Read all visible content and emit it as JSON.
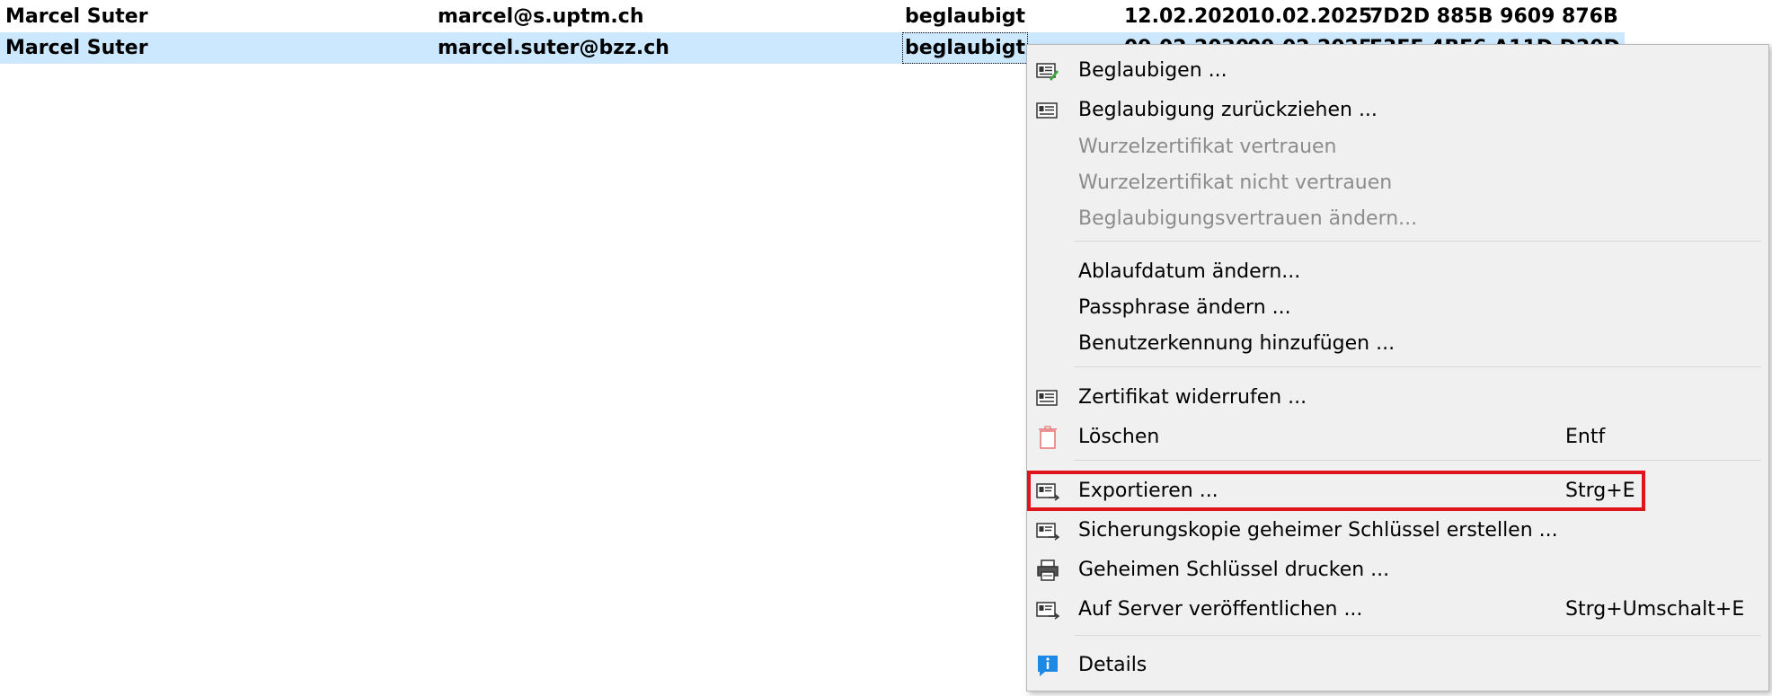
{
  "rows": [
    {
      "name": "Marcel Suter",
      "email": "marcel@s.uptm.ch",
      "status": "beglaubigt",
      "created": "12.02.2020",
      "expires": "10.02.2025",
      "fingerprint": "7D2D 885B 9609 876B"
    },
    {
      "name": "Marcel Suter",
      "email": "marcel.suter@bzz.ch",
      "status": "beglaubigt",
      "created": "09.02.2020",
      "expires": "09.02.2025",
      "fingerprint": "E3EF 4BE6 A11D D20D"
    }
  ],
  "menu": {
    "items": [
      {
        "label": "Beglaubigen ...",
        "icon": "certify-icon",
        "enabled": true
      },
      {
        "label": "Beglaubigung zurückziehen ...",
        "icon": "certificate-icon",
        "enabled": true
      },
      {
        "label": "Wurzelzertifikat vertrauen",
        "enabled": false
      },
      {
        "label": "Wurzelzertifikat nicht vertrauen",
        "enabled": false
      },
      {
        "label": "Beglaubigungsvertrauen ändern...",
        "enabled": false
      },
      {
        "label": "Ablaufdatum ändern...",
        "enabled": true
      },
      {
        "label": "Passphrase ändern ...",
        "enabled": true
      },
      {
        "label": "Benutzerkennung hinzufügen ...",
        "enabled": true
      },
      {
        "label": "Zertifikat widerrufen ...",
        "icon": "certificate-icon",
        "enabled": true
      },
      {
        "label": "Löschen",
        "icon": "trash-icon",
        "shortcut": "Entf",
        "enabled": true
      },
      {
        "label": "Exportieren ...",
        "icon": "export-icon",
        "shortcut": "Strg+E",
        "enabled": true
      },
      {
        "label": "Sicherungskopie geheimer Schlüssel erstellen ...",
        "icon": "export-icon",
        "enabled": true
      },
      {
        "label": "Geheimen Schlüssel drucken ...",
        "icon": "printer-icon",
        "enabled": true
      },
      {
        "label": "Auf Server veröffentlichen ...",
        "icon": "export-icon",
        "shortcut": "Strg+Umschalt+E",
        "enabled": true
      },
      {
        "label": "Details",
        "icon": "info-icon",
        "enabled": true
      }
    ]
  },
  "colors": {
    "selected_row": "#cce8ff",
    "highlight": "#e0141c",
    "menu_bg": "#f0f0f0",
    "disabled_text": "#8c8c8c"
  }
}
